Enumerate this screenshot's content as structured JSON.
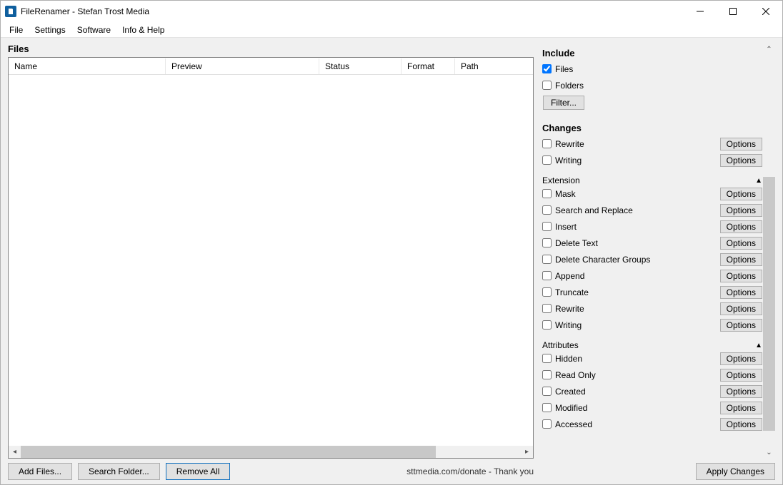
{
  "window": {
    "title": "FileRenamer - Stefan Trost Media"
  },
  "menu": {
    "file": "File",
    "settings": "Settings",
    "software": "Software",
    "info_help": "Info & Help"
  },
  "left": {
    "heading": "Files",
    "cols": {
      "name": "Name",
      "preview": "Preview",
      "status": "Status",
      "format": "Format",
      "path": "Path"
    },
    "buttons": {
      "add_files": "Add Files...",
      "search_folder": "Search Folder...",
      "remove_all": "Remove All"
    },
    "status_text": "sttmedia.com/donate - Thank you"
  },
  "right": {
    "include": {
      "heading": "Include",
      "files": "Files",
      "folders": "Folders",
      "filter": "Filter..."
    },
    "changes": {
      "heading": "Changes",
      "rewrite": "Rewrite",
      "writing": "Writing"
    },
    "extension": {
      "heading": "Extension",
      "mask": "Mask",
      "search_replace": "Search and Replace",
      "insert": "Insert",
      "delete_text": "Delete Text",
      "delete_char_groups": "Delete Character Groups",
      "append": "Append",
      "truncate": "Truncate",
      "rewrite": "Rewrite",
      "writing": "Writing"
    },
    "attributes": {
      "heading": "Attributes",
      "hidden": "Hidden",
      "read_only": "Read Only",
      "created": "Created",
      "modified": "Modified",
      "accessed": "Accessed"
    },
    "options_label": "Options",
    "apply": "Apply Changes"
  }
}
